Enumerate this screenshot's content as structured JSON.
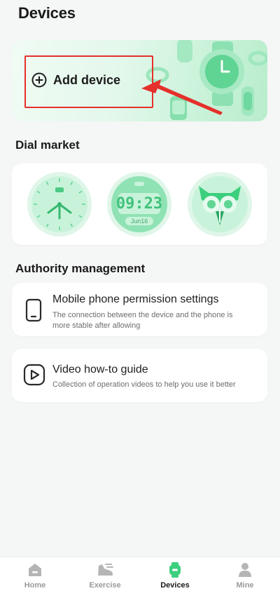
{
  "page": {
    "title": "Devices"
  },
  "add_device": {
    "label": "Add device",
    "icon": "plus-circle-icon"
  },
  "dial_market": {
    "title": "Dial market",
    "dials": [
      {
        "name": "analog-dial",
        "time_text": ""
      },
      {
        "name": "digital-dial",
        "time_text": "09:23",
        "date_text": "Jun16"
      },
      {
        "name": "owl-dial",
        "time_text": ""
      }
    ]
  },
  "authority": {
    "title": "Authority management",
    "items": [
      {
        "title": "Mobile phone permission settings",
        "subtitle": "The connection between the device and the phone is more stable after allowing",
        "icon": "phone-icon"
      },
      {
        "title": "Video how-to guide",
        "subtitle": "Collection of operation videos to help you use it better",
        "icon": "play-icon"
      }
    ]
  },
  "nav": {
    "items": [
      {
        "label": "Home",
        "icon": "home-icon",
        "active": false
      },
      {
        "label": "Exercise",
        "icon": "shoe-icon",
        "active": false
      },
      {
        "label": "Devices",
        "icon": "watch-icon",
        "active": true
      },
      {
        "label": "Mine",
        "icon": "person-icon",
        "active": false
      }
    ]
  },
  "colors": {
    "accent": "#3ccf7d",
    "highlight": "#e5302b",
    "dial_bg": "#c8f3da"
  }
}
